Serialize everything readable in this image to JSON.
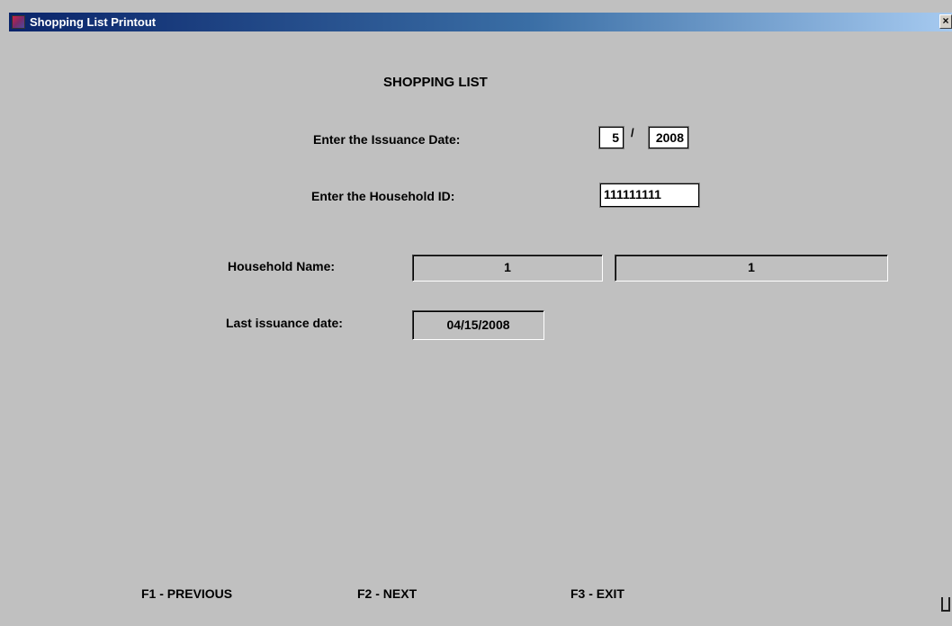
{
  "window": {
    "title": "Shopping List Printout",
    "close_glyph": "×"
  },
  "form": {
    "heading": "SHOPPING LIST",
    "issuance_date_label": "Enter the Issuance Date:",
    "issuance_month": "5",
    "date_separator": "/",
    "issuance_year": "2008",
    "household_id_label": "Enter the Household ID:",
    "household_id": "111111111",
    "household_name_label": "Household Name:",
    "household_name_first": "1",
    "household_name_last": "1",
    "last_issuance_label": "Last issuance date:",
    "last_issuance_date": "04/15/2008"
  },
  "function_keys": {
    "previous": "F1 - PREVIOUS",
    "next": "F2 - NEXT",
    "exit": "F3 - EXIT"
  },
  "icons": {
    "app": "app-icon",
    "close": "close-icon",
    "resize": "resize-grip-icon"
  },
  "colors": {
    "titlebar_start": "#0a246a",
    "titlebar_end": "#a6caf0",
    "background": "#c0c0c0"
  }
}
